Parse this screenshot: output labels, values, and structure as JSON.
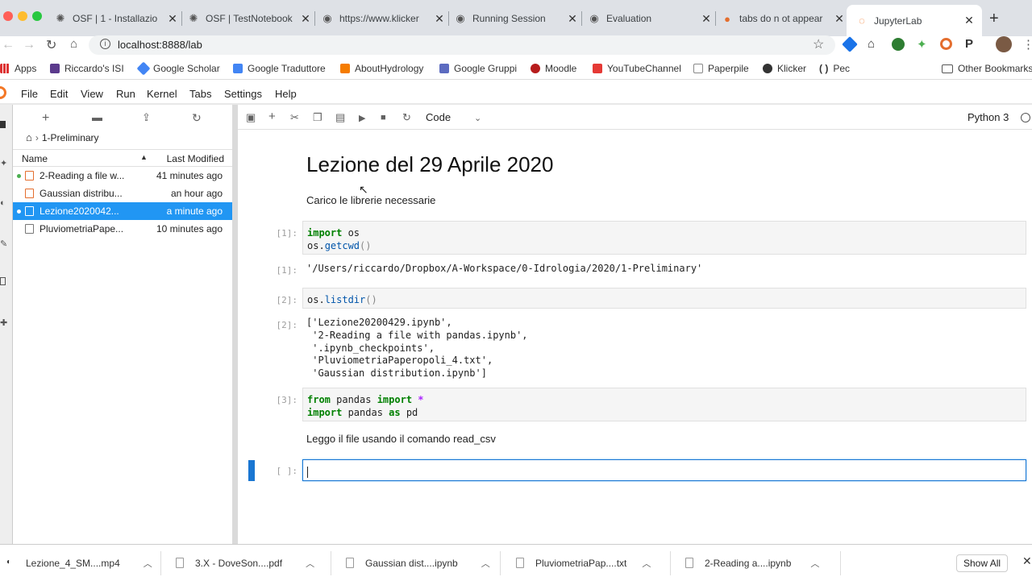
{
  "browser": {
    "tabs": [
      {
        "title": "OSF | 1 - Installazio",
        "icon": "osf-icon"
      },
      {
        "title": "OSF | TestNotebook",
        "icon": "osf-icon"
      },
      {
        "title": "https://www.klicker",
        "icon": "globe-icon"
      },
      {
        "title": "Running Session",
        "icon": "globe-icon"
      },
      {
        "title": "Evaluation",
        "icon": "globe-icon"
      },
      {
        "title": "tabs do n ot appear",
        "icon": "github-icon"
      },
      {
        "title": "JupyterLab",
        "icon": "jupyter-icon"
      }
    ],
    "url": "localhost:8888/lab",
    "bookmarks": [
      "Apps",
      "Riccardo's ISI",
      "Google Scholar",
      "Google Traduttore",
      "AboutHydrology",
      "Google Gruppi",
      "Moodle",
      "YouTubeChannel",
      "Paperpile",
      "Klicker",
      "Pec"
    ],
    "other_bookmarks": "Other Bookmarks"
  },
  "jupyter": {
    "menu": [
      "File",
      "Edit",
      "View",
      "Run",
      "Kernel",
      "Tabs",
      "Settings",
      "Help"
    ],
    "breadcrumb": "1-Preliminary",
    "columns": {
      "name": "Name",
      "modified": "Last Modified"
    },
    "files": [
      {
        "name": "2-Reading a file w...",
        "modified": "41 minutes ago",
        "type": "notebook",
        "running": true
      },
      {
        "name": "Gaussian distribu...",
        "modified": "an hour ago",
        "type": "notebook",
        "running": false
      },
      {
        "name": "Lezione2020042...",
        "modified": "a minute ago",
        "type": "notebook",
        "running": true,
        "selected": true
      },
      {
        "name": "PluviometriaPape...",
        "modified": "10 minutes ago",
        "type": "file",
        "running": false
      }
    ],
    "cell_type": "Code",
    "kernel": "Python 3"
  },
  "notebook": {
    "title": "Lezione del 29 Aprile 2020",
    "md1": "Carico le librerie necessarie",
    "cell1": {
      "prompt": "[1]:",
      "out_prompt": "[1]:",
      "output": "'/Users/riccardo/Dropbox/A-Workspace/0-Idrologia/2020/1-Preliminary'"
    },
    "cell2": {
      "prompt": "[2]:",
      "out_prompt": "[2]:",
      "output": "['Lezione20200429.ipynb',\n '2-Reading a file with pandas.ipynb',\n '.ipynb_checkpoints',\n 'PluviometriaPaperopoli_4.txt',\n 'Gaussian distribution.ipynb']"
    },
    "cell3": {
      "prompt": "[3]:"
    },
    "md2": "Leggo il file usando il comando read_csv",
    "cell4": {
      "prompt": "[ ]:"
    }
  },
  "downloads": [
    {
      "name": "Lezione_4_SM....mp4"
    },
    {
      "name": "3.X - DoveSon....pdf"
    },
    {
      "name": "Gaussian dist....ipynb"
    },
    {
      "name": "PluviometriaPap....txt"
    },
    {
      "name": "2-Reading a....ipynb"
    }
  ],
  "show_all": "Show All",
  "colors": {
    "accent": "#2196f3",
    "active_cell": "#1976d2",
    "notebook_icon": "#e46e2e"
  }
}
